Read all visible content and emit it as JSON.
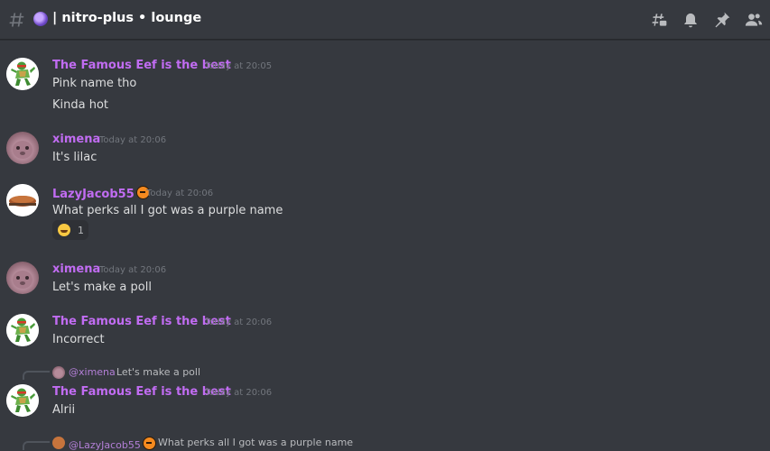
{
  "header": {
    "channel_name": "| nitro-plus • lounge",
    "icons": [
      "threads-icon",
      "notification-bell-icon",
      "pin-icon",
      "member-list-icon"
    ]
  },
  "colors": {
    "username": "#c16cf2",
    "background": "#36393f"
  },
  "messages": [
    {
      "author": "The Famous Eef is the best",
      "timestamp": "Today at 20:05",
      "lines": [
        "Pink name tho",
        "Kinda hot"
      ]
    },
    {
      "author": "ximena",
      "timestamp": "Today at 20:06",
      "lines": [
        "It's lilac"
      ]
    },
    {
      "author": "LazyJacob55",
      "timestamp": "Today at 20:06",
      "lines": [
        "What perks all I got was a purple name"
      ],
      "reaction": {
        "emoji": "rofl-emoji",
        "count": "1"
      }
    },
    {
      "author": "ximena",
      "timestamp": "Today at 20:06",
      "lines": [
        "Let's make a poll"
      ]
    },
    {
      "author": "The Famous Eef is the best",
      "timestamp": "Today at 20:06",
      "lines": [
        "Incorrect"
      ]
    },
    {
      "reply": {
        "author": "@ximena",
        "text": "Let's make a poll"
      },
      "author": "The Famous Eef is the best",
      "timestamp": "Today at 20:06",
      "lines": [
        "Alrii"
      ]
    },
    {
      "reply": {
        "author": "@LazyJacob55",
        "text": "What perks all I got was a purple name"
      }
    }
  ]
}
